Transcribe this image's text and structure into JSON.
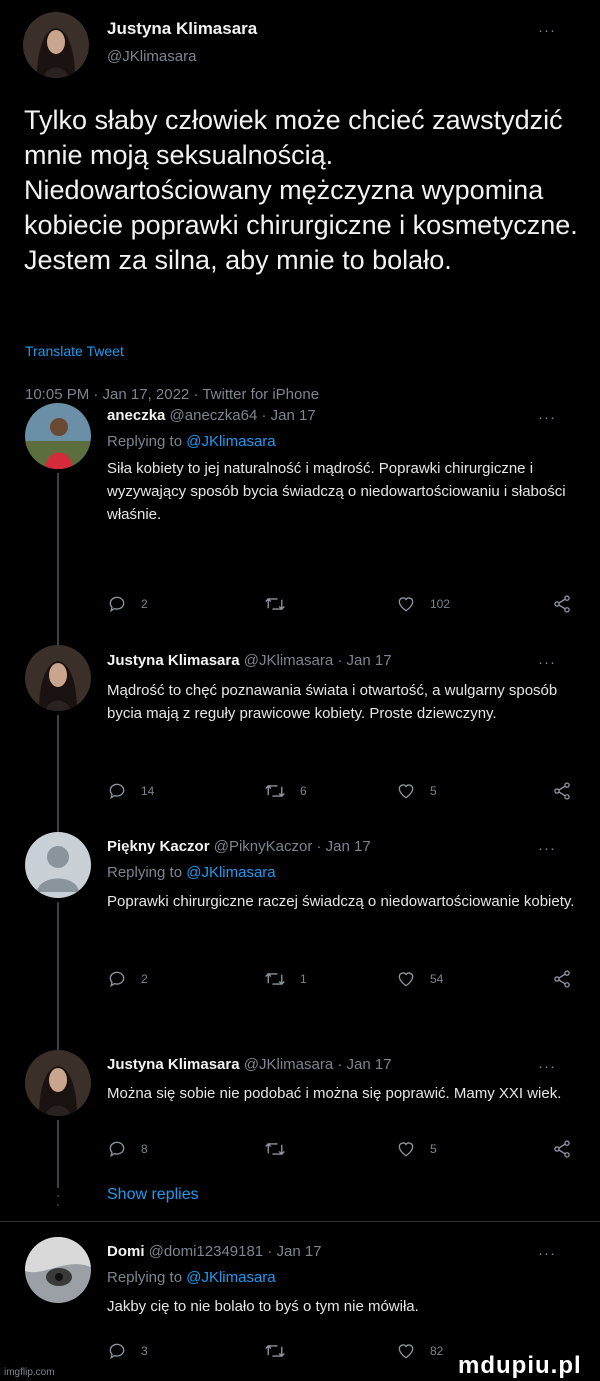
{
  "main_tweet": {
    "author_name": "Justyna Klimasara",
    "author_handle": "@JKlimasara",
    "more_label": "···",
    "text": "Tylko słaby człowiek może chcieć zawstydzić mnie moją seksualnością. Niedowartościowany mężczyzna wypomina kobiecie poprawki chirurgiczne i kosmetyczne. Jestem za silna, aby mnie to bolało.",
    "translate_label": "Translate Tweet",
    "meta": "10:05 PM · Jan 17, 2022 · Twitter for iPhone"
  },
  "replies": [
    {
      "author_name": "aneczka",
      "author_meta": "@aneczka64 · Jan 17",
      "replying_prefix": "Replying to",
      "replying_to": "@JKlimasara",
      "text": "Siła kobiety to jej naturalność i mądrość. Poprawki chirurgiczne i wyzywający sposób bycia świadczą o niedowartościowaniu i słabości właśnie.",
      "reply_count": "2",
      "retweet_count": "",
      "like_count": "102",
      "more_label": "···"
    },
    {
      "author_name": "Justyna Klimasara",
      "author_meta": "@JKlimasara · Jan 17",
      "text": "Mądrość to chęć poznawania świata i otwartość, a wulgarny sposób bycia mają z reguły prawicowe kobiety. Proste dziewczyny.",
      "reply_count": "14",
      "retweet_count": "6",
      "like_count": "5",
      "more_label": "···"
    },
    {
      "author_name": "Piękny Kaczor",
      "author_meta": "@PiknyKaczor · Jan 17",
      "replying_prefix": "Replying to",
      "replying_to": "@JKlimasara",
      "text": "Poprawki chirurgiczne raczej świadczą o niedowartościowanie kobiety.",
      "reply_count": "2",
      "retweet_count": "1",
      "like_count": "54",
      "more_label": "···"
    },
    {
      "author_name": "Justyna Klimasara",
      "author_meta": "@JKlimasara · Jan 17",
      "text": "Można się sobie nie podobać i można się poprawić. Mamy XXI wiek.",
      "reply_count": "8",
      "retweet_count": "",
      "like_count": "5",
      "more_label": "···"
    },
    {
      "author_name": "Domi",
      "author_meta": "@domi12349181 · Jan 17",
      "replying_prefix": "Replying to",
      "replying_to": "@JKlimasara",
      "text": "Jakby cię to nie bolało to byś o tym nie mówiła.",
      "reply_count": "3",
      "retweet_count": "",
      "like_count": "82",
      "more_label": "···"
    }
  ],
  "show_replies_label": "Show replies",
  "watermark_left": "imgflip.com",
  "watermark_right": "mdupiu.pl",
  "colors": {
    "background": "#000000",
    "accent": "#1d9bf0",
    "muted": "#7a8590",
    "text": "#e6e6e6"
  }
}
